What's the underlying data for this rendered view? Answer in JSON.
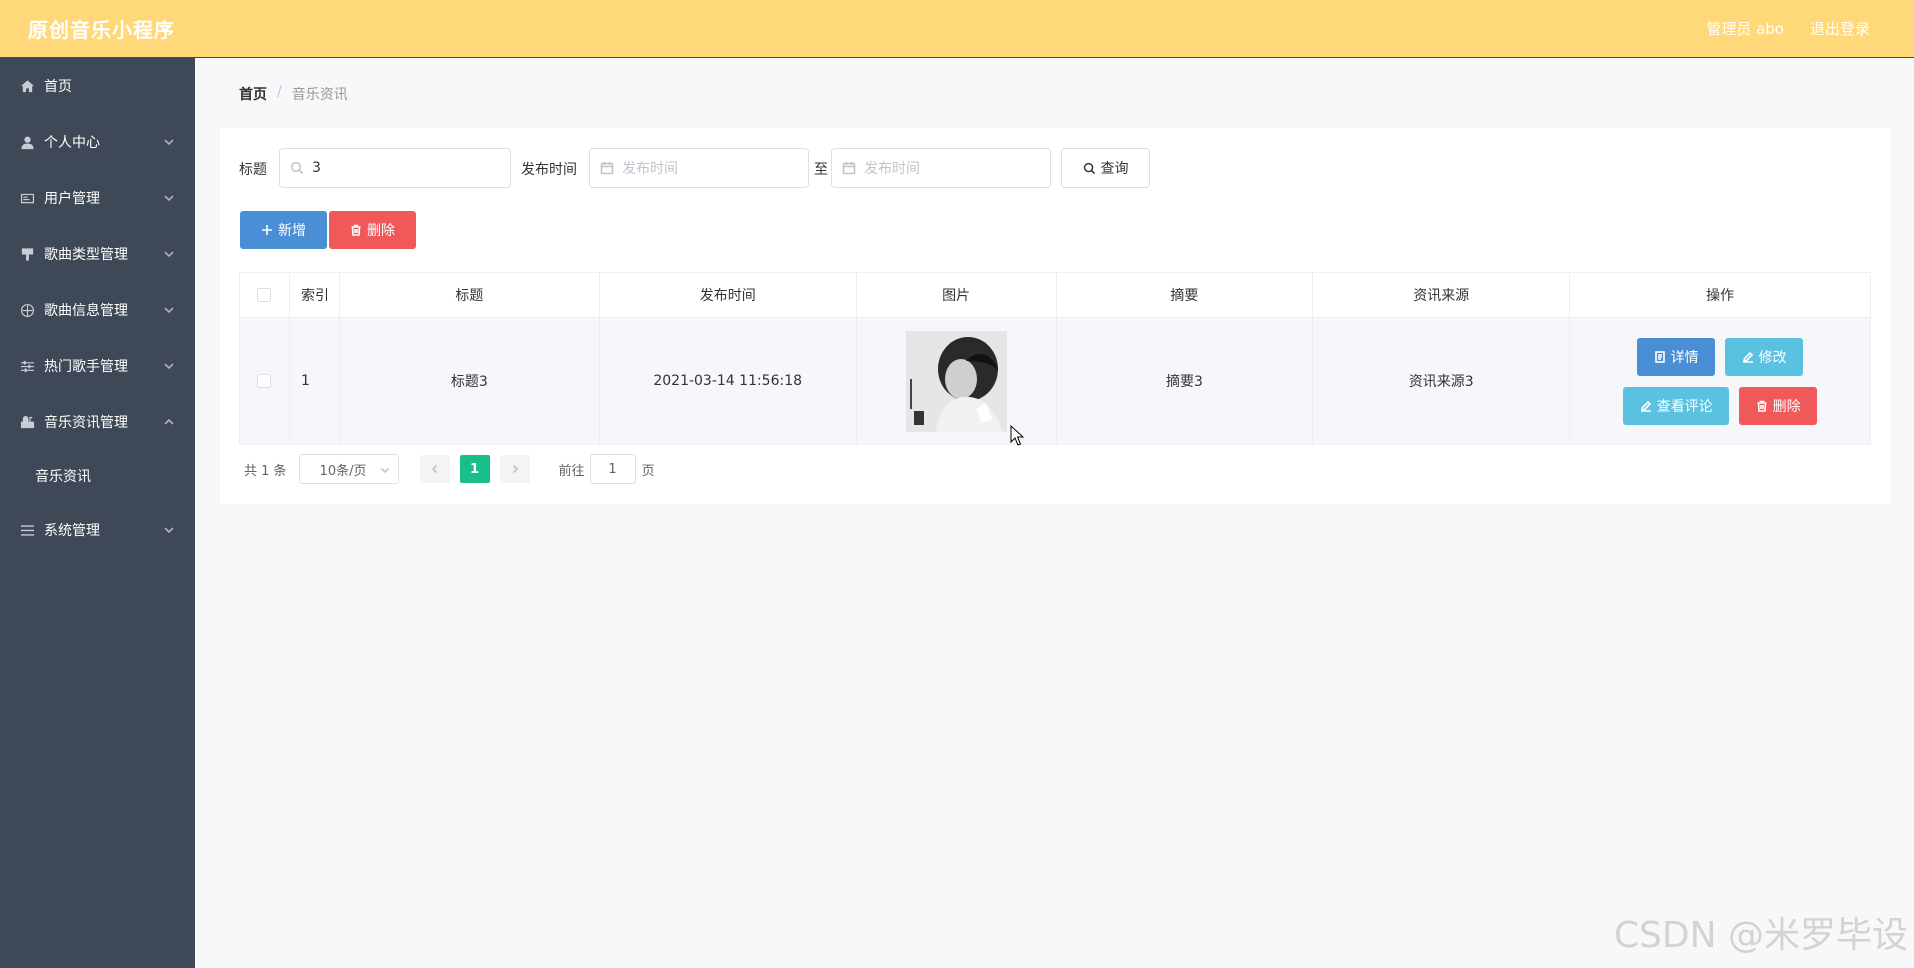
{
  "header": {
    "app_title": "原创音乐小程序",
    "admin_label": "管理员 abo",
    "logout": "退出登录"
  },
  "sidebar": {
    "items": [
      {
        "label": "首页",
        "icon": "home-icon"
      },
      {
        "label": "个人中心",
        "icon": "user-icon"
      },
      {
        "label": "用户管理",
        "icon": "id-card-icon"
      },
      {
        "label": "歌曲类型管理",
        "icon": "brush-icon"
      },
      {
        "label": "歌曲信息管理",
        "icon": "basketball-icon"
      },
      {
        "label": "热门歌手管理",
        "icon": "sliders-icon"
      },
      {
        "label": "音乐资讯管理",
        "icon": "mailbox-icon"
      },
      {
        "label": "系统管理",
        "icon": "list-icon"
      }
    ],
    "submenu": {
      "label": "音乐资讯"
    }
  },
  "breadcrumb": {
    "home": "首页",
    "separator": "/",
    "current": "音乐资讯"
  },
  "filters": {
    "title_label": "标题",
    "title_value": "3",
    "time_label": "发布时间",
    "start_placeholder": "发布时间",
    "range_sep": "至",
    "end_placeholder": "发布时间",
    "query_button": "查询"
  },
  "actions": {
    "add": "新增",
    "delete": "删除"
  },
  "table": {
    "columns": [
      "索引",
      "标题",
      "发布时间",
      "图片",
      "摘要",
      "资讯来源",
      "操作"
    ],
    "rows": [
      {
        "index": "1",
        "title": "标题3",
        "time": "2021-03-14 11:56:18",
        "summary": "摘要3",
        "source": "资讯来源3"
      }
    ],
    "row_actions": {
      "detail": "详情",
      "edit": "修改",
      "comments": "查看评论",
      "delete": "删除"
    }
  },
  "pagination": {
    "total": "共 1 条",
    "page_size": "10条/页",
    "current_page": "1",
    "goto_label": "前往",
    "goto_value": "1",
    "page_unit": "页"
  },
  "watermark": "CSDN @米罗毕设",
  "colors": {
    "topbar": "#ffd979",
    "sidebar": "#3f4856",
    "primary": "#4a8fd6",
    "danger": "#f0595a",
    "info": "#5bc1e0",
    "success": "#19be8b"
  }
}
